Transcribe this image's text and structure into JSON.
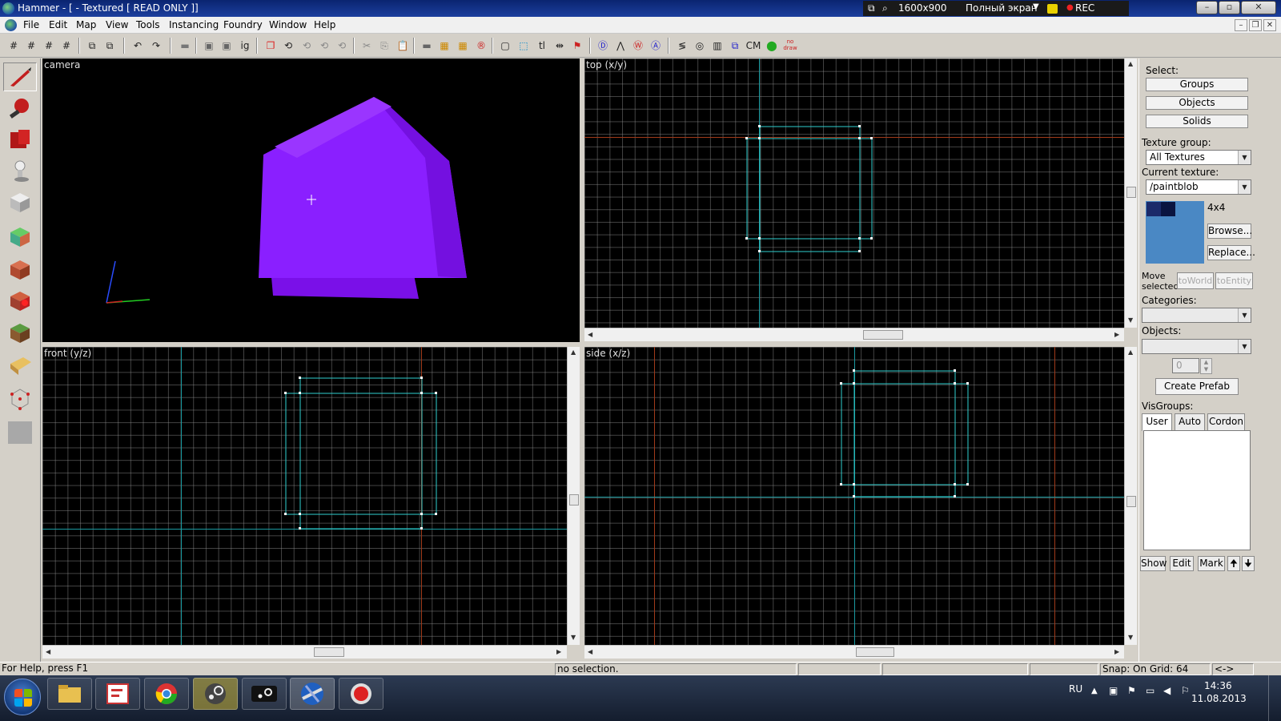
{
  "window": {
    "title": "Hammer - [ - Textured [ READ ONLY ]]",
    "recorder": {
      "resolution": "1600x900",
      "mode": "Полный экран",
      "rec_label": "REC"
    },
    "buttons": {
      "minimize": "–",
      "maximize": "▫",
      "close": "✕"
    }
  },
  "menu": [
    "File",
    "Edit",
    "Map",
    "View",
    "Tools",
    "Instancing",
    "Foundry",
    "Window",
    "Help"
  ],
  "toolbar": {
    "texts": {
      "ig": "ig",
      "tl": "tl",
      "cm": "CM",
      "nodraw": "no draw"
    },
    "icons": [
      "grid-icon",
      "grid-size-icon",
      "grid-smaller-icon",
      "grid-larger-icon",
      "undo-icon",
      "redo-icon",
      "cut-icon",
      "copy-icon",
      "paste-icon",
      "run-map-icon"
    ]
  },
  "left_tools": [
    "selection-tool-icon",
    "magnify-tool-icon",
    "camera-tool-icon",
    "entity-tool-icon",
    "block-tool-icon",
    "texture-application-icon",
    "apply-texture-icon",
    "decal-tool-icon",
    "overlay-tool-icon",
    "clipping-tool-icon",
    "vertex-tool-icon",
    "path-tool-icon"
  ],
  "viewports": {
    "camera": "camera",
    "top": "top (x/y)",
    "front": "front (y/z)",
    "side": "side (x/z)"
  },
  "panel": {
    "select_label": "Select:",
    "groups": "Groups",
    "objects": "Objects",
    "solids": "Solids",
    "texture_group_label": "Texture group:",
    "texture_group_value": "All Textures",
    "current_texture_label": "Current texture:",
    "current_texture_value": "/paintblob",
    "texture_size": "4x4",
    "browse": "Browse...",
    "replace": "Replace...",
    "move_selected_label_1": "Move",
    "move_selected_label_2": "selected:",
    "to_world": "toWorld",
    "to_entity": "toEntity",
    "categories_label": "Categories:",
    "objects_label": "Objects:",
    "prefab_count": "0",
    "create_prefab": "Create Prefab",
    "visgroups_label": "VisGroups:",
    "tabs": [
      "User",
      "Auto",
      "Cordon"
    ],
    "show": "Show",
    "edit": "Edit",
    "mark": "Mark",
    "up": "🠉",
    "down": "🠋"
  },
  "status": {
    "help": "For Help, press F1",
    "selection": "no selection.",
    "snap": "Snap: On Grid: 64",
    "arrows": "<->"
  },
  "taskbar": {
    "apps": [
      "explorer-icon",
      "foxit-reader-icon",
      "chrome-icon",
      "steam-icon",
      "steam-alt-icon",
      "hammer-icon",
      "recorder-icon"
    ],
    "lang": "RU",
    "time": "14:36",
    "date": "11.08.2013"
  },
  "colors": {
    "accent_cube": "#8a1fff",
    "grid_line": "#969696",
    "axis_teal": "#1a9aa0",
    "axis_red": "#a03a1a",
    "selection_outline": "#2fd0d0",
    "titlebar": "#0a2470"
  }
}
